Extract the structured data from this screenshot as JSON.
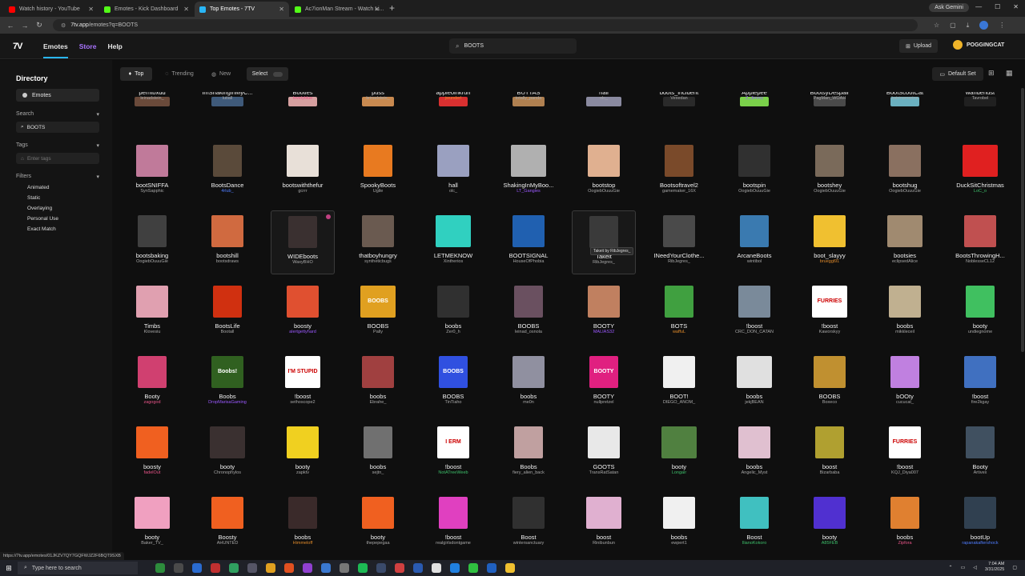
{
  "browser": {
    "tabs": [
      {
        "title": "Watch history - YouTube",
        "fav": "#ff0000",
        "active": false
      },
      {
        "title": "Emotes - Kick Dashboard",
        "fav": "#53fc18",
        "active": false
      },
      {
        "title": "Top Emotes - 7TV",
        "fav": "#29b6f6",
        "active": true
      },
      {
        "title": "Ac7ionMan Stream - Watch Li...",
        "fav": "#53fc18",
        "active": false
      }
    ],
    "ask_gemini": "Ask Gemini",
    "url_host": "7tv.app",
    "url_path": "/emotes?q=BOOTS"
  },
  "header": {
    "logo": "7tv-logo",
    "nav": {
      "emotes": "Emotes",
      "store": "Store",
      "help": "Help"
    },
    "search_value": "BOOTS",
    "upload_label": "Upload",
    "username": "POGGINGCAT"
  },
  "sidebar": {
    "title": "Directory",
    "emotes_pill": "Emotes",
    "search_label": "Search",
    "search_value": "BOOTS",
    "tags_label": "Tags",
    "tags_placeholder": "Enter tags",
    "filters_label": "Filters",
    "filters": [
      "Animated",
      "Static",
      "Overlaying",
      "Personal Use",
      "Exact Match"
    ]
  },
  "toolbar": {
    "top": "Top",
    "trending": "Trending",
    "new": "New",
    "select": "Select",
    "default_set": "Default Set"
  },
  "tooltip": "Takeit by RibJegres_",
  "status_url": "https://7tv.app/emotes/01JKZV7QY7GQFWJZ2F6BQT9SXB",
  "taskbar": {
    "search_placeholder": "Type here to search",
    "time": "7:04 AM",
    "date": "3/31/2025"
  },
  "emotes": [
    [
      {
        "name": "perritoxdd",
        "owner": "leinadstein_",
        "oc": "",
        "thumb": "#6a4a3a"
      },
      {
        "name": "ImShakingInMyC...",
        "owner": "lutiall",
        "oc": "",
        "thumb": "#3f5a7a"
      },
      {
        "name": "Booties",
        "owner": "lovelyblue",
        "oc": "pink",
        "thumb": "#d6a0a0"
      },
      {
        "name": "puss",
        "owner": "leinadstein_",
        "oc": "",
        "thumb": "#c98a50"
      },
      {
        "name": "appleoinkrun",
        "owner": "jwunderl",
        "oc": "orange",
        "thumb": "#d83030"
      },
      {
        "name": "BUTTAS",
        "owner": "totally_panda",
        "oc": "",
        "thumb": "#b08050"
      },
      {
        "name": "hall",
        "owner": "olc_",
        "oc": "",
        "thumb": "#8a8aa0"
      },
      {
        "name": "boots_incident",
        "owner": "Vexedan",
        "oc": "",
        "thumb": "#2a2a2a"
      },
      {
        "name": "Applepee",
        "owner": "Z_Jimmy",
        "oc": "purple",
        "thumb": "#7ad04a"
      },
      {
        "name": "BootsyDespair",
        "owner": "PagMan_WOAH",
        "oc": "",
        "thumb": "#4a4a4a"
      },
      {
        "name": "BootScootCat",
        "owner": "katrinamarina",
        "oc": "",
        "thumb": "#6ab0c0"
      },
      {
        "name": "wanderlust",
        "owner": "Tavrobel",
        "oc": "",
        "thumb": "#202020"
      }
    ],
    [
      {
        "name": "bootSNIFFA",
        "owner": "SynSapphic",
        "oc": "",
        "thumb": "#c07a9a"
      },
      {
        "name": "BootsDance",
        "owner": "4rlub_",
        "oc": "blue",
        "thumb": "#5a4a3a"
      },
      {
        "name": "bootswiththefur",
        "owner": "gcrrr",
        "oc": "",
        "thumb": "#e8e0d8"
      },
      {
        "name": "SpookyBoots",
        "owner": "Ugile",
        "oc": "",
        "thumb": "#e87a20"
      },
      {
        "name": "hall",
        "owner": "olc_",
        "oc": "",
        "thumb": "#9aa0c0"
      },
      {
        "name": "ShakingInMyBoo...",
        "owner": "LT_Gangies",
        "oc": "purple",
        "thumb": "#b0b0b0"
      },
      {
        "name": "bootstop",
        "owner": "OogiebOuuuGie",
        "oc": "",
        "thumb": "#e0b090"
      },
      {
        "name": "Bootsoftravel2",
        "owner": "gamemaker_16X",
        "oc": "",
        "thumb": "#7a4a2a"
      },
      {
        "name": "bootspin",
        "owner": "OogiebOuuuGie",
        "oc": "",
        "thumb": "#303030"
      },
      {
        "name": "bootshey",
        "owner": "OogiebOuuuGie",
        "oc": "",
        "thumb": "#7a6a5a"
      },
      {
        "name": "bootshug",
        "owner": "OogiebOuuuGie",
        "oc": "",
        "thumb": "#8a7060"
      },
      {
        "name": "DuckSitChristmas",
        "owner": "LoC_o",
        "oc": "green",
        "thumb": "#e02020"
      }
    ],
    [
      {
        "name": "bootsbaking",
        "owner": "OogiebOuuuGie",
        "oc": "",
        "thumb": "#404040"
      },
      {
        "name": "bootshill",
        "owner": "bootsdraws",
        "oc": "",
        "thumb": "#d06a40"
      },
      {
        "name": "WIDEboots",
        "owner": "WaxyBHO",
        "oc": "",
        "thumb": "#3a3030",
        "hover": true
      },
      {
        "name": "thatboyhungry",
        "owner": "syntheticbugs",
        "oc": "",
        "thumb": "#6a5a50"
      },
      {
        "name": "LETMEKNOW",
        "owner": "Xintherios",
        "oc": "",
        "thumb": "#30d0c0"
      },
      {
        "name": "BOOTSIGNAL",
        "owner": "HouseOfPhobia",
        "oc": "",
        "thumb": "#2060b0"
      },
      {
        "name": "Takeit",
        "owner": "RibJegres_",
        "oc": "",
        "thumb": "#3a3a3a",
        "hover": true
      },
      {
        "name": "INeedYourClothe...",
        "owner": "RibJegres_",
        "oc": "",
        "thumb": "#4a4a4a"
      },
      {
        "name": "ArcaneBoots",
        "owner": "wintibol",
        "oc": "",
        "thumb": "#3a7ab0"
      },
      {
        "name": "boot_slayyy",
        "owner": "brueggl91",
        "oc": "orange",
        "thumb": "#f0c030"
      },
      {
        "name": "bootsies",
        "owner": "eclipsedAlice",
        "oc": "",
        "thumb": "#a08a70"
      },
      {
        "name": "BootsThrowingH...",
        "owner": "NoblesseCL12",
        "oc": "",
        "thumb": "#c05050"
      }
    ],
    [
      {
        "name": "Timbs",
        "owner": "Klovesiu",
        "oc": "",
        "thumb": "#e0a0b0"
      },
      {
        "name": "BootsLife",
        "owner": "Bootall",
        "oc": "",
        "thumb": "#d03010"
      },
      {
        "name": "boosty",
        "owner": "alertgettyhard",
        "oc": "purple",
        "thumb": "#e05030"
      },
      {
        "name": "BOOBS",
        "owner": "Pally",
        "oc": "",
        "thumb": "#e0a020",
        "text": "BOOBS"
      },
      {
        "name": "boobs",
        "owner": "Zer0_h",
        "oc": "",
        "thumb": "#303030"
      },
      {
        "name": "BOOBS",
        "owner": "leinad_osnola",
        "oc": "",
        "thumb": "#6a5060"
      },
      {
        "name": "BOOTY",
        "owner": "MALIAS32",
        "oc": "purple",
        "thumb": "#c08060"
      },
      {
        "name": "BOTS",
        "owner": "waffuL",
        "oc": "orange",
        "thumb": "#40a040"
      },
      {
        "name": "!boost",
        "owner": "CRC_DON_CATAN",
        "oc": "",
        "thumb": "#7a8a9a"
      },
      {
        "name": "!boost",
        "owner": "Kaworskyy",
        "oc": "",
        "thumb": "#ffffff",
        "text": "FURRIES"
      },
      {
        "name": "boobs",
        "owner": "mikkleceil",
        "oc": "",
        "thumb": "#c0b090"
      },
      {
        "name": "booty",
        "owner": "undiegnome",
        "oc": "",
        "thumb": "#40c060"
      }
    ],
    [
      {
        "name": "Booty",
        "owner": "zagogod",
        "oc": "pink",
        "thumb": "#d04070"
      },
      {
        "name": "Boobs",
        "owner": "DropMarisaGaming",
        "oc": "purple",
        "thumb": "#306020",
        "text": "Boobs!"
      },
      {
        "name": "!boost",
        "owner": "sethoscope2",
        "oc": "",
        "thumb": "#ffffff",
        "text": "I'M STUPID"
      },
      {
        "name": "boobs",
        "owner": "Ebrahe_",
        "oc": "",
        "thumb": "#a04040"
      },
      {
        "name": "BOOBS",
        "owner": "TinTiaho",
        "oc": "",
        "thumb": "#3050e0",
        "text": "BOOBS"
      },
      {
        "name": "boobs",
        "owner": "me0n",
        "oc": "",
        "thumb": "#9090a0"
      },
      {
        "name": "BOOTY",
        "owner": "nullpretzel",
        "oc": "",
        "thumb": "#e02080",
        "text": "BOOTY"
      },
      {
        "name": "BOOT!",
        "owner": "DIEGO_ANOM_",
        "oc": "",
        "thumb": "#f0f0f0"
      },
      {
        "name": "boobs",
        "owner": "jekjBEAN",
        "oc": "",
        "thumb": "#e0e0e0"
      },
      {
        "name": "BOOBS",
        "owner": "Boxeco",
        "oc": "",
        "thumb": "#c09030"
      },
      {
        "name": "bOOty",
        "owner": "cucucat_",
        "oc": "",
        "thumb": "#c080e0"
      },
      {
        "name": "!boost",
        "owner": "fire2kgay",
        "oc": "",
        "thumb": "#4070c0"
      }
    ],
    [
      {
        "name": "boosty",
        "owner": "fadelOut",
        "oc": "pink",
        "thumb": "#f06020"
      },
      {
        "name": "booty",
        "owner": "Chronophylos",
        "oc": "",
        "thumb": "#3a3030"
      },
      {
        "name": "booty",
        "owner": "zapktv",
        "oc": "",
        "thumb": "#f0d020"
      },
      {
        "name": "boobs",
        "owner": "sejtn_",
        "oc": "",
        "thumb": "#707070"
      },
      {
        "name": "!boost",
        "owner": "NotATreeWeeb",
        "oc": "green",
        "thumb": "#ffffff",
        "text": "I ERM"
      },
      {
        "name": "Boobs",
        "owner": "fiery_alien_back",
        "oc": "",
        "thumb": "#c0a0a0"
      },
      {
        "name": "GOOTS",
        "owner": "TransRatSatan",
        "oc": "",
        "thumb": "#e8e8e8"
      },
      {
        "name": "booty",
        "owner": "Longair",
        "oc": "green",
        "thumb": "#508040"
      },
      {
        "name": "boobs",
        "owner": "Angelic_Myst",
        "oc": "",
        "thumb": "#e0c0d0"
      },
      {
        "name": "boost",
        "owner": "Bizarbaba",
        "oc": "",
        "thumb": "#b0a030"
      },
      {
        "name": "!boost",
        "owner": "KQJ_Diya007",
        "oc": "",
        "thumb": "#ffffff",
        "text": "FURRIES"
      },
      {
        "name": "Booty",
        "owner": "Artivex",
        "oc": "",
        "thumb": "#405060"
      }
    ],
    [
      {
        "name": "booty",
        "owner": "Baker_TV_",
        "oc": "",
        "thumb": "#f0a0c0"
      },
      {
        "name": "Boosty",
        "owner": "AHUNTED",
        "oc": "",
        "thumb": "#f06020"
      },
      {
        "name": "boobs",
        "owner": "Himmeloff",
        "oc": "orange",
        "thumb": "#3a2a2a"
      },
      {
        "name": "booty",
        "owner": "thepepegaa",
        "oc": "",
        "thumb": "#f06020"
      },
      {
        "name": "!boost",
        "owner": "realgirlsdontgame",
        "oc": "",
        "thumb": "#e040c0"
      },
      {
        "name": "Boost",
        "owner": "wintersanctuary",
        "oc": "",
        "thumb": "#303030"
      },
      {
        "name": "boost",
        "owner": "Rinibunbun",
        "oc": "",
        "thumb": "#e0b0d0"
      },
      {
        "name": "boobs",
        "owner": "ewpert1",
        "oc": "",
        "thumb": "#f0f0f0"
      },
      {
        "name": "Boost",
        "owner": "IlianoKokoro",
        "oc": "green",
        "thumb": "#40c0c0"
      },
      {
        "name": "booty",
        "owner": "A85FEB",
        "oc": "green",
        "thumb": "#5030d0"
      },
      {
        "name": "boobs",
        "owner": "Zipfora",
        "oc": "pink",
        "thumb": "#e08030"
      },
      {
        "name": "bootUp",
        "owner": "rapanakaftershock",
        "oc": "blue",
        "thumb": "#304050"
      }
    ]
  ]
}
